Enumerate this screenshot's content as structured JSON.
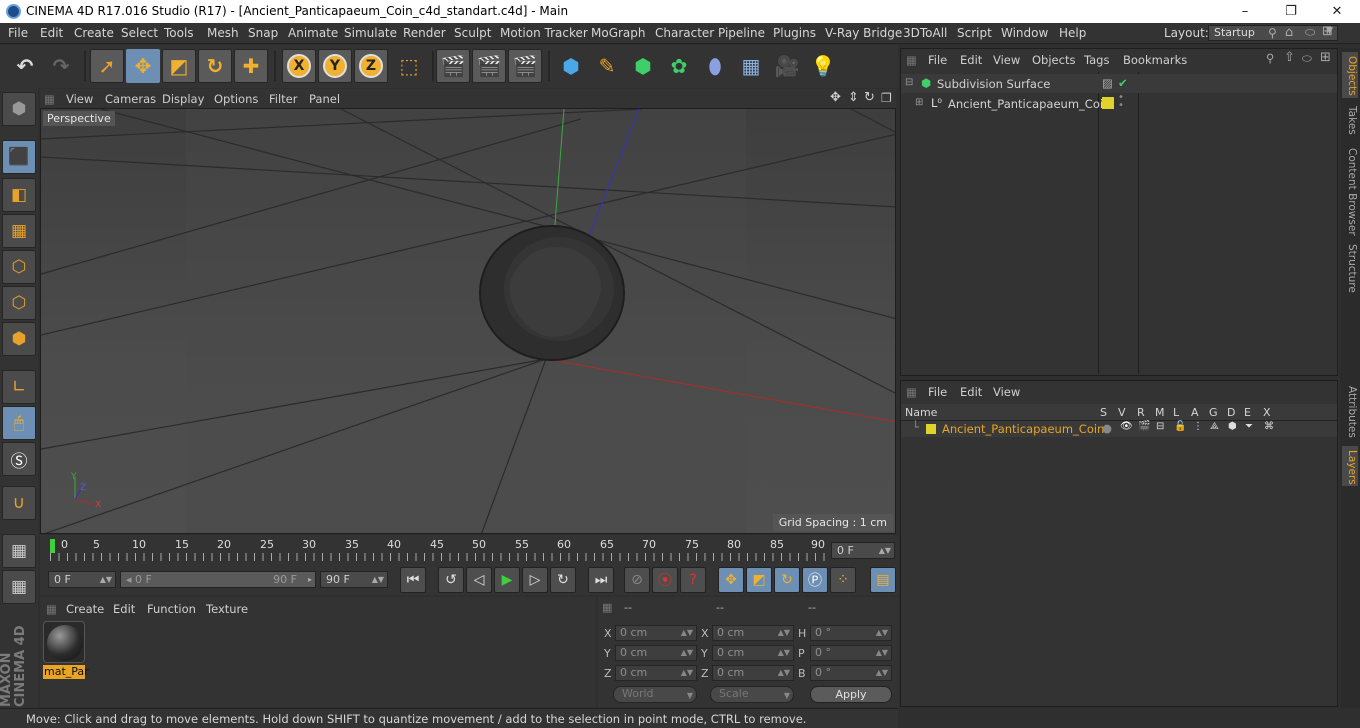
{
  "window": {
    "title": "CINEMA 4D R17.016 Studio (R17) - [Ancient_Panticapaeum_Coin_c4d_standart.c4d] - Main",
    "minimize": "–",
    "maximize": "❐",
    "close": "✕"
  },
  "menu": [
    "File",
    "Edit",
    "Create",
    "Select",
    "Tools",
    "Mesh",
    "Snap",
    "Animate",
    "Simulate",
    "Render",
    "Sculpt",
    "Motion Tracker",
    "MoGraph",
    "Character",
    "Pipeline",
    "Plugins",
    "V-Ray Bridge",
    "3DToAll",
    "Script",
    "Window",
    "Help"
  ],
  "layout": {
    "label": "Layout:",
    "value": "Startup"
  },
  "toolbar_icons": [
    "undo-icon",
    "redo-icon",
    "live-select-icon",
    "move-icon",
    "scale-icon",
    "rotate-icon",
    "add-icon",
    "x-axis-icon",
    "y-axis-icon",
    "z-axis-icon",
    "coordinate-system-icon",
    "render-view-icon",
    "render-picture-viewer-icon",
    "edit-render-settings-icon",
    "cube-icon",
    "pen-icon",
    "subdivision-icon",
    "cloner-icon",
    "deformer-icon",
    "floor-icon",
    "camera-icon",
    "light-icon"
  ],
  "toolbar_glyphs": {
    "xaxis": "X",
    "yaxis": "Y",
    "zaxis": "Z"
  },
  "viewport": {
    "menu": [
      "View",
      "Cameras",
      "Display",
      "Options",
      "Filter",
      "Panel"
    ],
    "label": "Perspective",
    "grid_spacing": "Grid Spacing : 1 cm"
  },
  "timeline": {
    "ticks": [
      "0",
      "5",
      "10",
      "15",
      "20",
      "25",
      "30",
      "35",
      "40",
      "45",
      "50",
      "55",
      "60",
      "65",
      "70",
      "75",
      "80",
      "85",
      "90"
    ],
    "current_frame": "0 F"
  },
  "transport": {
    "start": "0 F",
    "slider_left": "0 F",
    "slider_right": "90 F",
    "end": "90 F"
  },
  "material_manager": {
    "menu": [
      "Create",
      "Edit",
      "Function",
      "Texture"
    ],
    "material_name": "mat_Par"
  },
  "coordinates": {
    "headers": [
      "--",
      "--",
      "--"
    ],
    "rows": [
      {
        "l1": "X",
        "v1": "0 cm",
        "l2": "X",
        "v2": "0 cm",
        "l3": "H",
        "v3": "0 °"
      },
      {
        "l1": "Y",
        "v1": "0 cm",
        "l2": "Y",
        "v2": "0 cm",
        "l3": "P",
        "v3": "0 °"
      },
      {
        "l1": "Z",
        "v1": "0 cm",
        "l2": "Z",
        "v2": "0 cm",
        "l3": "B",
        "v3": "0 °"
      }
    ],
    "mode": "World",
    "transform": "Scale",
    "apply": "Apply"
  },
  "status": "Move: Click and drag to move elements. Hold down SHIFT to quantize movement / add to the selection in point mode, CTRL to remove.",
  "objects_panel": {
    "menu": [
      "File",
      "Edit",
      "View",
      "Objects",
      "Tags",
      "Bookmarks"
    ],
    "items": [
      {
        "name": "Subdivision Surface"
      },
      {
        "name": "Ancient_Panticapaeum_Coin"
      }
    ]
  },
  "layers_panel": {
    "menu": [
      "File",
      "Edit",
      "View"
    ],
    "columns": [
      "Name",
      "S",
      "V",
      "R",
      "M",
      "L",
      "A",
      "G",
      "D",
      "E",
      "X"
    ],
    "layer_name": "Ancient_Panticapaeum_Coin",
    "layer_color": "#e0d22a"
  },
  "side_tabs": [
    "Objects",
    "Takes",
    "Content Browser",
    "Structure",
    "Attributes",
    "Layers"
  ],
  "brand": "MAXON CINEMA 4D"
}
